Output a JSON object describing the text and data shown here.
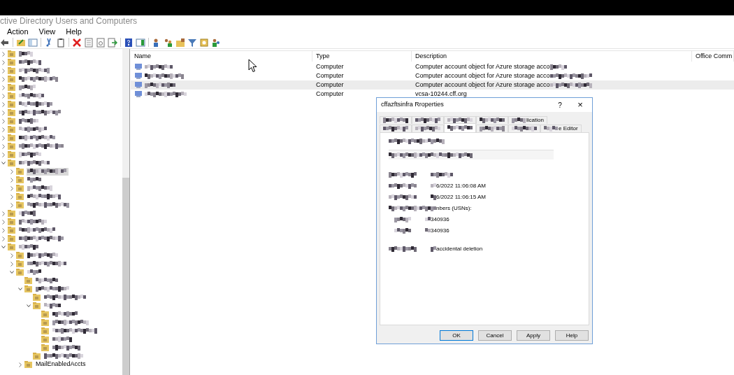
{
  "window": {
    "title": "ctive Directory Users and Computers"
  },
  "menu": [
    "Action",
    "View",
    "Help"
  ],
  "toolbar": [
    {
      "kind": "back"
    },
    {
      "kind": "sep"
    },
    {
      "kind": "up"
    },
    {
      "kind": "tree"
    },
    {
      "kind": "sep"
    },
    {
      "kind": "cut"
    },
    {
      "kind": "paste"
    },
    {
      "kind": "sep"
    },
    {
      "kind": "delete"
    },
    {
      "kind": "props"
    },
    {
      "kind": "refresh"
    },
    {
      "kind": "export"
    },
    {
      "kind": "sep"
    },
    {
      "kind": "help"
    },
    {
      "kind": "pane"
    },
    {
      "kind": "sep"
    },
    {
      "kind": "user"
    },
    {
      "kind": "group"
    },
    {
      "kind": "ou"
    },
    {
      "kind": "filter"
    },
    {
      "kind": "find"
    },
    {
      "kind": "users"
    }
  ],
  "tree": [
    {
      "expanded": false,
      "selected": false
    },
    {
      "expanded": false,
      "selected": false
    },
    {
      "expanded": false,
      "selected": false
    },
    {
      "expanded": false,
      "selected": false
    },
    {
      "expanded": false,
      "selected": false
    },
    {
      "expanded": false,
      "selected": false
    },
    {
      "expanded": false,
      "selected": false
    },
    {
      "expanded": false,
      "selected": false
    },
    {
      "expanded": false,
      "selected": false
    },
    {
      "expanded": false,
      "selected": false
    },
    {
      "expanded": false,
      "selected": false
    },
    {
      "expanded": false,
      "selected": false
    },
    {
      "expanded": false,
      "selected": false
    },
    {
      "expanded": true,
      "selected": false,
      "children": [
        {
          "expanded": false,
          "selected": true
        },
        {
          "expanded": false,
          "selected": false
        },
        {
          "expanded": false,
          "selected": false
        },
        {
          "expanded": false,
          "selected": false
        },
        {
          "expanded": false,
          "selected": false
        }
      ]
    },
    {
      "expanded": false,
      "selected": false
    },
    {
      "expanded": false,
      "selected": false
    },
    {
      "expanded": false,
      "selected": false
    },
    {
      "expanded": false,
      "selected": false
    },
    {
      "expanded": true,
      "selected": false,
      "children": [
        {
          "expanded": false,
          "selected": false
        },
        {
          "expanded": false,
          "selected": false
        },
        {
          "expanded": true,
          "selected": false,
          "children": [
            {
              "selected": false
            },
            {
              "expanded": true,
              "selected": false,
              "children": [
                {
                  "selected": false
                },
                {
                  "expanded": true,
                  "selected": false,
                  "children": [
                    {
                      "selected": false
                    },
                    {
                      "selected": false
                    },
                    {
                      "selected": false
                    },
                    {
                      "selected": false
                    },
                    {
                      "selected": false
                    }
                  ]
                },
                {
                  "selected": false
                }
              ]
            },
            {
              "label": "MailEnabledAccts",
              "expanded": false,
              "selected": false
            }
          ]
        }
      ]
    }
  ],
  "table": {
    "columns": [
      "Name",
      "Type",
      "Description",
      "Office Comm"
    ],
    "rows": [
      {
        "type": "Computer",
        "description": "Computer account object for Azure storage acco",
        "selected": false
      },
      {
        "type": "Computer",
        "description": "Computer account object for Azure storage acco",
        "selected": false
      },
      {
        "type": "Computer",
        "description": "Computer account object for Azure storage acco",
        "selected": true
      },
      {
        "type": "Computer",
        "description": "vcsa-10244.cff.org",
        "selected": false
      }
    ]
  },
  "dialog": {
    "title": "cffazftsinfra Rroperties",
    "help": "?",
    "close": "×",
    "tab_rows": [
      [
        {
          "selected": false
        },
        {
          "selected": false
        },
        {
          "selected": false
        },
        {
          "selected": false
        },
        {
          "label": "lication",
          "selected": false
        }
      ],
      [
        {
          "selected": false
        },
        {
          "selected": false
        },
        {
          "selected": true
        },
        {
          "selected": false
        },
        {
          "selected": false
        },
        {
          "label": "e Editor",
          "selected": false
        }
      ]
    ],
    "fields": [
      {
        "kind": "pair"
      },
      {
        "kind": "pair",
        "value": "6/2022 11:06:08 AM"
      },
      {
        "kind": "pair",
        "value": "6/2022 11:06:15 AM"
      },
      {
        "kind": "pair",
        "value": "nbers (USNs):"
      },
      {
        "kind": "sub",
        "value": "340936"
      },
      {
        "kind": "sub",
        "value": "340936"
      },
      {
        "kind": "gap"
      },
      {
        "kind": "pair",
        "value": "accidental deletion"
      }
    ],
    "buttons": [
      {
        "label": "OK",
        "default": true
      },
      {
        "label": "Cancel",
        "default": false
      },
      {
        "label": "Apply",
        "default": false
      },
      {
        "label": "Help",
        "default": false
      }
    ]
  }
}
